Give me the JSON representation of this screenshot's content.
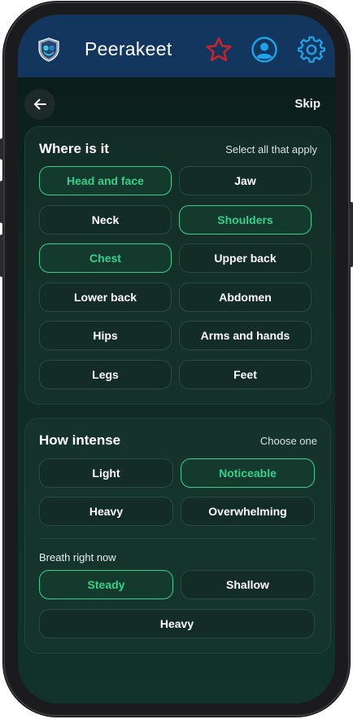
{
  "app": {
    "title": "Peerakeet"
  },
  "colors": {
    "accent": "#34d08c",
    "appbar": "#13365f",
    "star": "#c8232c",
    "user_icon": "#1fa3e8"
  },
  "icons": {
    "logo": "shield-logo",
    "favorite": "star-outline-icon",
    "profile": "user-circle-icon",
    "settings": "gear-icon",
    "back": "arrow-left-icon"
  },
  "nav": {
    "skip_label": "Skip"
  },
  "where": {
    "title": "Where is it",
    "hint": "Select all that apply",
    "options": [
      {
        "label": "Head and face",
        "selected": true
      },
      {
        "label": "Jaw",
        "selected": false
      },
      {
        "label": "Neck",
        "selected": false
      },
      {
        "label": "Shoulders",
        "selected": true
      },
      {
        "label": "Chest",
        "selected": true
      },
      {
        "label": "Upper back",
        "selected": false
      },
      {
        "label": "Lower back",
        "selected": false
      },
      {
        "label": "Abdomen",
        "selected": false
      },
      {
        "label": "Hips",
        "selected": false
      },
      {
        "label": "Arms and hands",
        "selected": false
      },
      {
        "label": "Legs",
        "selected": false
      },
      {
        "label": "Feet",
        "selected": false
      }
    ]
  },
  "intensity": {
    "title": "How intense",
    "hint": "Choose one",
    "options": [
      {
        "label": "Light",
        "selected": false
      },
      {
        "label": "Noticeable",
        "selected": true
      },
      {
        "label": "Heavy",
        "selected": false
      },
      {
        "label": "Overwhelming",
        "selected": false
      }
    ]
  },
  "breath": {
    "label": "Breath right now",
    "options": [
      {
        "label": "Steady",
        "selected": true
      },
      {
        "label": "Shallow",
        "selected": false
      },
      {
        "label": "Heavy",
        "selected": false
      }
    ]
  }
}
